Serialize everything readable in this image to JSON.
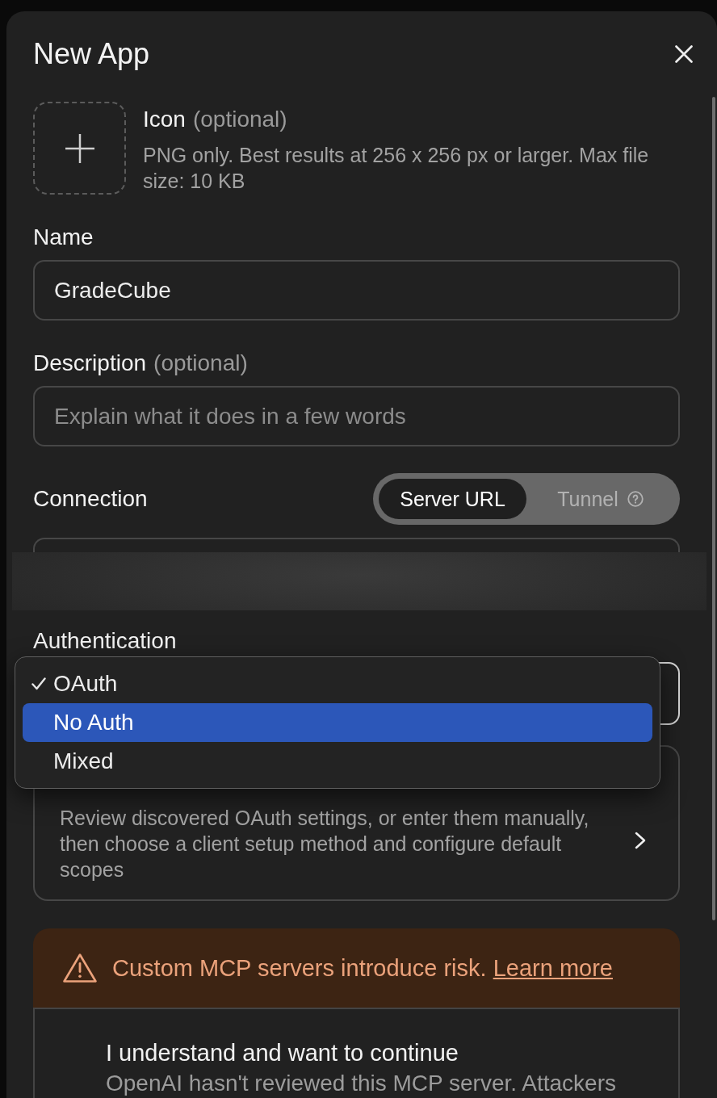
{
  "dialog": {
    "title": "New App"
  },
  "icon_upload": {
    "label": "Icon",
    "optional": "(optional)",
    "help": "PNG only. Best results at 256 x 256 px or larger. Max file size: 10 KB"
  },
  "fields": [
    {
      "label": "Name",
      "value": "GradeCube"
    },
    {
      "label": "Description",
      "optional": "(optional)",
      "placeholder": "Explain what it does in a few words"
    }
  ],
  "connection": {
    "label": "Connection",
    "options": [
      {
        "label": "Server URL",
        "selected": true,
        "help_icon": false
      },
      {
        "label": "Tunnel",
        "selected": false,
        "help_icon": true
      }
    ]
  },
  "authentication": {
    "label": "Authentication",
    "menu_open": true,
    "options": [
      {
        "label": "OAuth",
        "checked": true,
        "highlighted": false
      },
      {
        "label": "No Auth",
        "checked": false,
        "highlighted": true
      },
      {
        "label": "Mixed",
        "checked": false,
        "highlighted": false
      }
    ]
  },
  "advanced_oauth": {
    "description": "Review discovered OAuth settings, or enter them manually, then choose a client setup method and configure default scopes"
  },
  "warning": {
    "message": "Custom MCP servers introduce risk.",
    "link": "Learn more",
    "consent_title": "I understand and want to continue",
    "consent_text": "OpenAI hasn't reviewed this MCP server. Attackers"
  }
}
